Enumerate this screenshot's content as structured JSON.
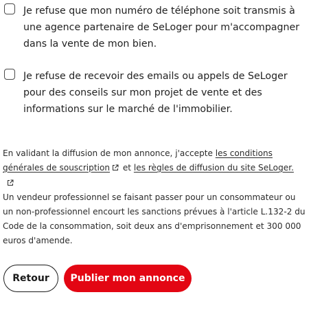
{
  "consents": [
    {
      "label": "Je refuse que mon numéro de téléphone soit transmis à une agence partenaire de SeLoger pour m'accompagner dans la vente de mon bien.",
      "checked": false
    },
    {
      "label": "Je refuse de recevoir des emails ou appels de SeLoger pour des conseils sur mon projet de vente et des informations sur le marché de l'immobilier.",
      "checked": false
    }
  ],
  "legal": {
    "intro": "En validant la diffusion de mon annonce, j'accepte ",
    "link_conditions": "les conditions générales de souscription",
    "connector": " et ",
    "link_rules": "les règles de diffusion du site SeLoger.",
    "warning": "Un vendeur professionnel se faisant passer pour un consommateur ou un non-professionnel encourt les sanctions prévues à l'article L.132-2 du Code de la consommation, soit deux ans d'emprisonnement et 300 000 euros d'amende."
  },
  "actions": {
    "back_label": "Retour",
    "publish_label": "Publier mon annonce"
  },
  "colors": {
    "primary": "#e30613",
    "text": "#1a1a1a"
  },
  "icons": {
    "external_link": "external-link-icon",
    "checkbox": "checkbox-unchecked"
  }
}
